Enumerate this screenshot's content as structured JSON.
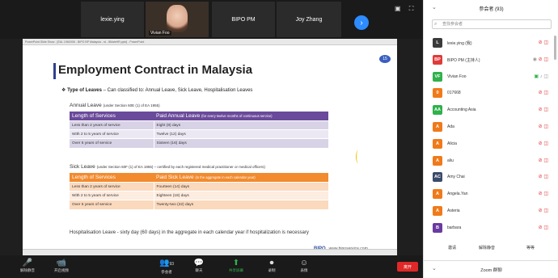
{
  "gallery": {
    "tiles": [
      "lexie.ying",
      "Vivian Foo",
      "BIPO PM",
      "Joy Zhang"
    ],
    "next_icon": "chevron-right-icon",
    "view_icons": "▣ ⛶"
  },
  "share_window": {
    "titlebar_text": "PowerPoint Slide Show - [EAL 1960X06 - BIPO BP Malaysia - rd - 8MaleHR.pptx] - PowerPoint"
  },
  "slide": {
    "title": "Employment Contract in Malaysia",
    "badge": "15",
    "types_bullet": "❖",
    "types_label": "Type of Leaves",
    "types_text": " – Can classified to:  Annual Leave, Sick Leave, Hospitalisation Leaves",
    "annual": {
      "label": "Annual Leave",
      "note": "(under Section 60E (1) of EA 1955)",
      "head_left": "Length of Services",
      "head_right": "Paid Annual Leave",
      "head_right_note": "(for every twelve months of continuous service)",
      "rows": [
        [
          "Less than 2 years of service",
          "Eight (8) days"
        ],
        [
          "With 2 to 5 years of service",
          "Twelve (12) days"
        ],
        [
          "Over 5 years of service",
          "Sixteen (16) days"
        ]
      ]
    },
    "sick": {
      "label": "Sick Leave",
      "note": "(under Section 60F (1) of EA 1955) – certified by each registered medical practitioner or medical officers)",
      "head_left": "Length of Services",
      "head_right": "Paid Sick Leave",
      "head_right_note": "(in the aggregate in each calendar year)",
      "rows": [
        [
          "Less than 2 years of service",
          "Fourteen (14) days"
        ],
        [
          "With 2 to 5 years of service",
          "Eighteen (18) days"
        ],
        [
          "Over 5 years of service",
          "Twenty-two (22) days"
        ]
      ]
    },
    "hosp_label": "Hospitalisation Leave",
    "hosp_text": " - sixty day (60 days) in the aggregate in each calendar year if hospitalization is necessary",
    "brand": "BIPO",
    "website": "www.biposervice.com"
  },
  "toolbar": {
    "buttons": [
      {
        "icon": "🎤",
        "label": "解除静音"
      },
      {
        "icon": "📹",
        "label": "开启视频"
      },
      {
        "icon": "👥",
        "label": "参会者",
        "count": "93"
      },
      {
        "icon": "💬",
        "label": "聊天"
      },
      {
        "icon": "⬆",
        "label": "共享屏幕"
      },
      {
        "icon": "⏺",
        "label": "录制"
      },
      {
        "icon": "☺",
        "label": "表情"
      }
    ],
    "end_label": "离开"
  },
  "panel": {
    "title": "参会者 (93)",
    "search_placeholder": "查找参会者",
    "participants": [
      {
        "initials": "L",
        "color": "#3a3a3a",
        "name": "lexie.ying (我)",
        "icons": "🎤̸ 📷̸"
      },
      {
        "initials": "BP",
        "color": "#e03a3a",
        "name": "BIPO PM (主持人)",
        "icons": "◉ 🎤̸ 📷̸"
      },
      {
        "initials": "VF",
        "color": "#2fb14b",
        "name": "Vivian Foo",
        "icons": "▣ 🎤 📷"
      },
      {
        "initials": "0",
        "color": "#f07a1a",
        "name": "017668",
        "icons": "🎤̸ 📷̸"
      },
      {
        "initials": "AA",
        "color": "#2fb14b",
        "name": "Accounting Asia",
        "icons": "🎤̸ 📷̸"
      },
      {
        "initials": "A",
        "color": "#f07a1a",
        "name": "Ada",
        "icons": "🎤̸ 📷̸"
      },
      {
        "initials": "A",
        "color": "#f07a1a",
        "name": "Alicia",
        "icons": "🎤̸ 📷̸"
      },
      {
        "initials": "A",
        "color": "#f07a1a",
        "name": "aliu",
        "icons": "🎤̸ 📷̸"
      },
      {
        "initials": "AC",
        "color": "#3a4a6a",
        "name": "Amy Chai",
        "icons": "🎤̸ 📷̸"
      },
      {
        "initials": "A",
        "color": "#f07a1a",
        "name": "Angela.Yan",
        "icons": "🎤̸ 📷̸"
      },
      {
        "initials": "A",
        "color": "#f07a1a",
        "name": "Asteria",
        "icons": "🎤̸ 📷̸"
      },
      {
        "initials": "B",
        "color": "#6a3aa0",
        "name": "barbara",
        "icons": "🎤̸ 📷̸"
      }
    ],
    "actions": {
      "invite": "邀请",
      "unmute_all": "解除静音",
      "more": "等等"
    },
    "zoom_group": "Zoom 群聊"
  }
}
